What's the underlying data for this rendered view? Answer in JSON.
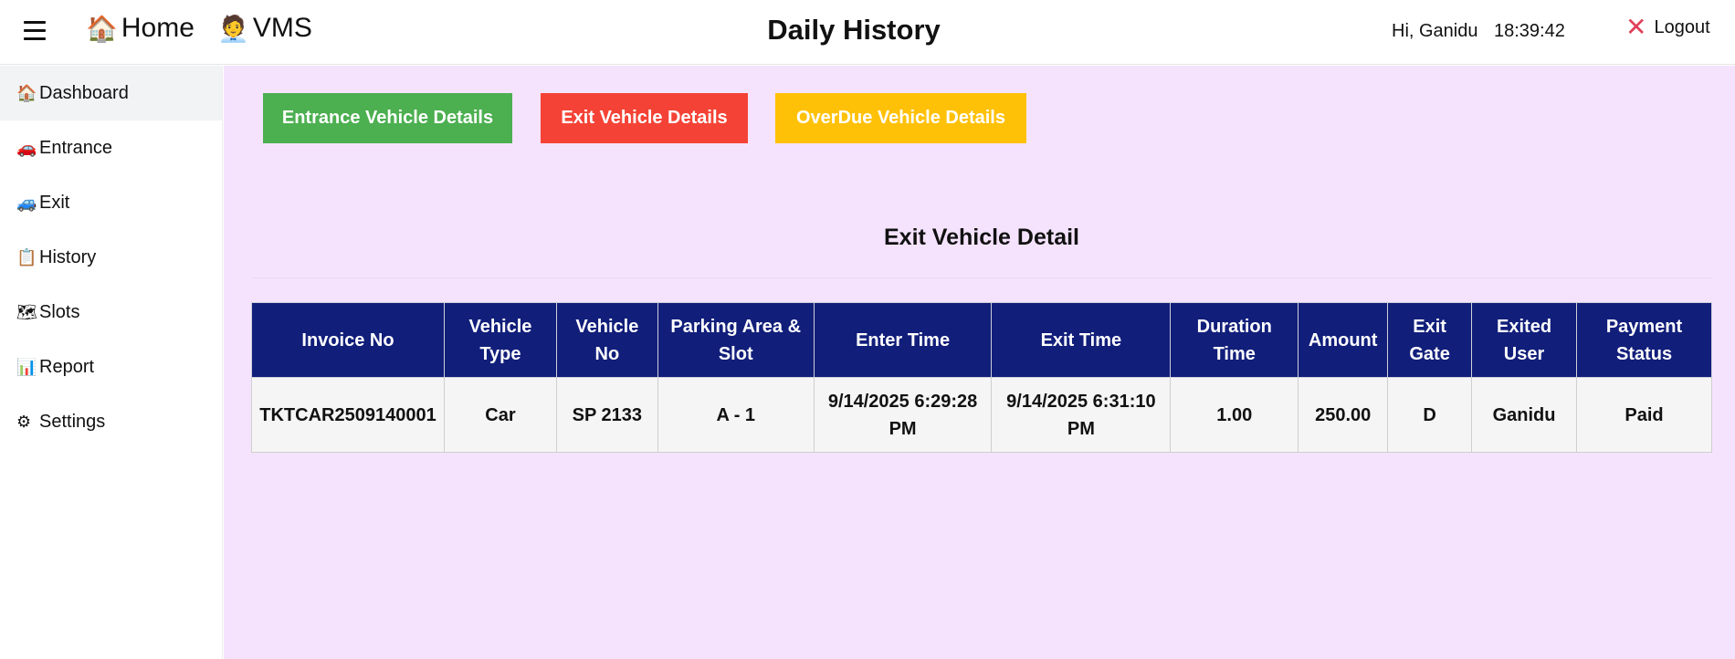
{
  "header": {
    "menu_icon": "hamburger-icon",
    "home_label": "Home",
    "home_icon": "🏠",
    "vms_label": "VMS",
    "vms_icon": "🧑‍💼",
    "title": "Daily History",
    "greeting": "Hi, Ganidu",
    "time": "18:39:42",
    "logout_label": "Logout",
    "logout_icon": "✕"
  },
  "sidebar": {
    "items": [
      {
        "icon": "🏠",
        "label": "Dashboard"
      },
      {
        "icon": "🚗",
        "label": "Entrance"
      },
      {
        "icon": "🚙",
        "label": "Exit"
      },
      {
        "icon": "📋",
        "label": "History"
      },
      {
        "icon": "🗺",
        "label": "Slots"
      },
      {
        "icon": "📊",
        "label": "Report"
      },
      {
        "icon": "⚙",
        "label": "Settings"
      }
    ]
  },
  "actions": {
    "entrance_label": "Entrance Vehicle Details",
    "exit_label": "Exit Vehicle Details",
    "overdue_label": "OverDue Vehicle Details"
  },
  "section": {
    "title": "Exit Vehicle Detail"
  },
  "table": {
    "headers": [
      "Invoice No",
      "Vehicle Type",
      "Vehicle No",
      "Parking Area & Slot",
      "Enter Time",
      "Exit Time",
      "Duration Time",
      "Amount",
      "Exit Gate",
      "Exited User",
      "Payment Status"
    ],
    "rows": [
      [
        "TKTCAR2509140001",
        "Car",
        "SP 2133",
        "A - 1",
        "9/14/2025 6:29:28 PM",
        "9/14/2025 6:31:10 PM",
        "1.00",
        "250.00",
        "D",
        "Ganidu",
        "Paid"
      ]
    ]
  },
  "colors": {
    "entrance_button": "#4caf50",
    "exit_button": "#f44336",
    "overdue_button": "#ffc107",
    "table_header": "#111e7a",
    "main_background": "#f5e3fd"
  }
}
